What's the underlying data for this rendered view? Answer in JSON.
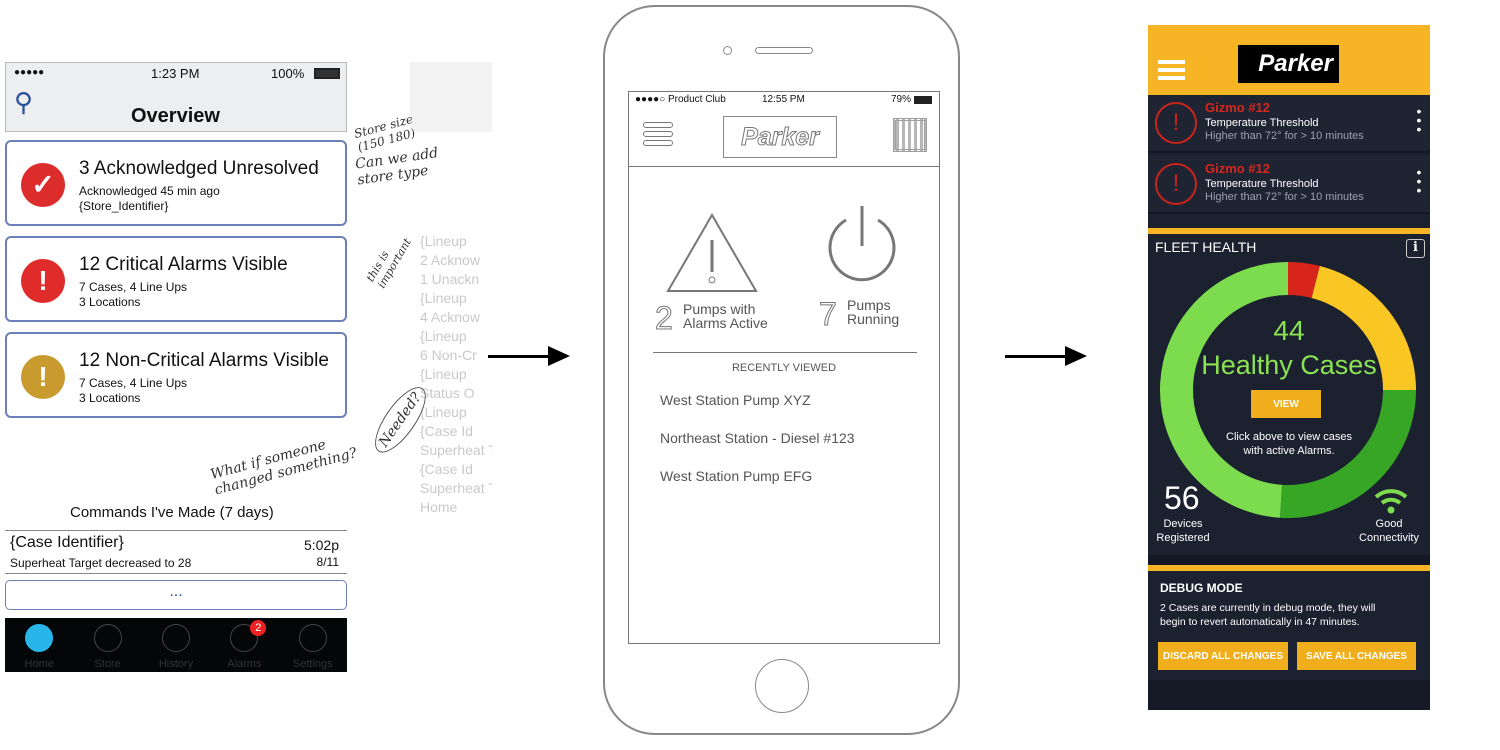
{
  "sketch": {
    "status": {
      "signal": "●●●●●",
      "time": "1:23 PM",
      "battery": "100%"
    },
    "title": "Overview",
    "cards": [
      {
        "title": "3 Acknowledged Unresolved",
        "line1": "Acknowledged 45 min ago",
        "line2": "{Store_Identifier}",
        "icon": "check-circle-icon",
        "color": "#dd2c2c",
        "glyph": "✓"
      },
      {
        "title": "12 Critical Alarms Visible",
        "line1": "7 Cases, 4 Line Ups",
        "line2": "3 Locations",
        "icon": "exclamation-icon",
        "color": "#e02b2b",
        "glyph": "!"
      },
      {
        "title": "12 Non-Critical Alarms Visible",
        "line1": "7 Cases, 4 Line Ups",
        "line2": "3 Locations",
        "icon": "exclamation-icon",
        "color": "#c99a2e",
        "glyph": "!"
      }
    ],
    "commands_title": "Commands I've Made (7 days)",
    "command": {
      "case": "{Case Identifier}",
      "desc": "Superheat Target decreased to 28",
      "time": "5:02p",
      "date": "8/11"
    },
    "more": "...",
    "tabs": [
      {
        "label": "Home"
      },
      {
        "label": "Store"
      },
      {
        "label": "History"
      },
      {
        "label": "Alarms",
        "badge": "2"
      },
      {
        "label": "Settings"
      }
    ],
    "notes": {
      "n1": "Store size (150 180)",
      "n2": "Can we add store type",
      "n3": "What if someone changed something?",
      "n4": "Needed?",
      "n5": "this is important"
    }
  },
  "ghost": {
    "items": [
      "{Lineup",
      "2 Acknow",
      "1 Unackn",
      "{Lineup",
      "4 Acknow",
      "{Lineup",
      "6 Non-Cr",
      "{Lineup",
      "Status O",
      "{Lineup",
      "{Case Id",
      "Superheat T",
      "{Case Id",
      "Superheat T",
      "Home"
    ]
  },
  "wire": {
    "status": {
      "carrier": "●●●●○ Product Club",
      "time": "12:55 PM",
      "battery": "79%"
    },
    "logo": "Parker",
    "stat1": {
      "num": "2",
      "label1": "Pumps with",
      "label2": "Alarms Active"
    },
    "stat2": {
      "num": "7",
      "label1": "Pumps",
      "label2": "Running"
    },
    "recent_title": "RECENTLY VIEWED",
    "recent": [
      "West Station Pump XYZ",
      "Northeast Station - Diesel #123",
      "West Station Pump EFG"
    ]
  },
  "app": {
    "logo": "Parker",
    "accent": "#f7b526",
    "alarms": [
      {
        "name": "Gizmo #12",
        "type": "Temperature Threshold",
        "detail": "Higher than 72° for > 10 minutes"
      },
      {
        "name": "Gizmo #12",
        "type": "Temperature Threshold",
        "detail": "Higher than 72° for > 10 minutes"
      }
    ],
    "fleet_title": "FLEET HEALTH",
    "healthy_count": "44",
    "healthy_label": "Healthy Cases",
    "view": "VIEW",
    "hint1": "Click above to view cases",
    "hint2": "with active Alarms.",
    "devices": "56",
    "devices_l1": "Devices",
    "devices_l2": "Registered",
    "conn_l1": "Good",
    "conn_l2": "Connectivity",
    "debug_title": "DEBUG MODE",
    "debug_text1": "2 Cases are currently in debug mode, they will",
    "debug_text2": "begin to revert automatically in 47 minutes.",
    "discard": "DISCARD ALL CHANGES",
    "save": "SAVE ALL CHANGES",
    "donut": [
      {
        "color": "#d8251c",
        "fraction": 0.04
      },
      {
        "color": "#f9c623",
        "fraction": 0.21
      },
      {
        "color": "#36a624",
        "fraction": 0.26
      },
      {
        "color": "#7ddc4e",
        "fraction": 0.49
      }
    ]
  }
}
